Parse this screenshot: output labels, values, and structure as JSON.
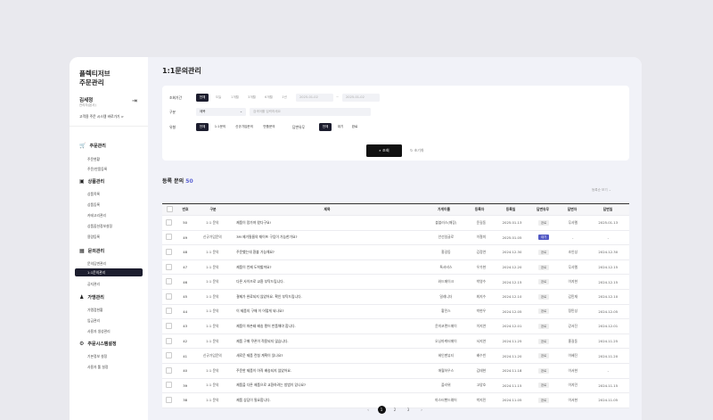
{
  "sidebar": {
    "brand_line1": "플렉티저브",
    "brand_line2": "주문관리",
    "user_name": "김세정",
    "user_sub": "관리자(본사)",
    "site_link": "고객용 주문 시스템 바로가기 >",
    "groups": [
      {
        "label": "주문관리",
        "items": [
          "주문현황",
          "주문/반품등록"
        ]
      },
      {
        "label": "상품관리",
        "items": [
          "상품목록",
          "상품등록",
          "카테고리관리",
          "상품옵션정보설정",
          "용량등록"
        ]
      },
      {
        "label": "문의관리",
        "items": [
          "문의답변관리",
          "1:1문의관리",
          "공지관리"
        ]
      },
      {
        "label": "가맹관리",
        "items": [
          "가맹점현황",
          "입금관리",
          "사용자 생성관리"
        ]
      },
      {
        "label": "주문시스템설정",
        "items": [
          "기본정보 설정",
          "사용자 툴 설정"
        ]
      }
    ]
  },
  "page_title": "1:1문의관리",
  "filter": {
    "period_label": "조회기간",
    "period_chips": [
      "전체",
      "오늘",
      "1개월",
      "3개월",
      "6개월",
      "1년"
    ],
    "date_from": "2025-01-02",
    "date_sep": "~",
    "date_to": "2025-01-02",
    "type_label": "구분",
    "type_select": "제목",
    "type_placeholder": "검색어를 입력하세요",
    "kind_label": "유형",
    "kind_chips": [
      "전체",
      "1:1문의",
      "신규가입문의",
      "반품문의"
    ],
    "answer_label": "답변유무",
    "answer_chips": [
      "전체",
      "대기",
      "완료"
    ],
    "search_btn": "조회",
    "reset_btn": "초기화"
  },
  "list": {
    "title": "등록 문의",
    "count": "50",
    "sort": "등록순 보기 ⌄",
    "columns": [
      "번호",
      "구분",
      "제목",
      "가게이름",
      "등록자",
      "등록일",
      "답변유무",
      "답변자",
      "답변일"
    ],
    "rows": [
      {
        "no": "50",
        "type": "1:1 문의",
        "title": "제품이 망가져 왔다구요!",
        "shop": "블블러스(매장)",
        "writer": "윤길동",
        "date": "2025.01.13",
        "status": "완료",
        "replier": "무사멜",
        "rdate": "2025.01.13"
      },
      {
        "no": "49",
        "type": "신규가입문의",
        "title": "3M 제거필름의 재이프 구입이 가능한가요?",
        "shop": "안선일글로",
        "writer": "이철미",
        "date": "2025.01.05",
        "status": "대기",
        "replier": "-",
        "rdate": "-"
      },
      {
        "no": "48",
        "type": "1:1 문의",
        "title": "주문했는데 환불 가능해요?",
        "shop": "홍길동",
        "writer": "김정연",
        "date": "2024.12.30",
        "status": "완료",
        "replier": "조인성",
        "rdate": "2024.12.30"
      },
      {
        "no": "47",
        "type": "1:1 문의",
        "title": "제품이 언제 도착할까요?",
        "shop": "톡서비스",
        "writer": "우가현",
        "date": "2024.12.20",
        "status": "완료",
        "replier": "무사멜",
        "rdate": "2024.12.15"
      },
      {
        "no": "46",
        "type": "1:1 문의",
        "title": "다른 사이즈로 교환 부탁드립니다.",
        "shop": "와드메이크",
        "writer": "박영수",
        "date": "2024.12.15",
        "status": "완료",
        "replier": "이지현",
        "rdate": "2024.12.15"
      },
      {
        "no": "45",
        "type": "1:1 문의",
        "title": "결제가 완료되지 않았어요. 확인 부탁드립니다.",
        "shop": "밀레니더",
        "writer": "최지수",
        "date": "2024.12.10",
        "status": "완료",
        "replier": "김민재",
        "rdate": "2024.12.10"
      },
      {
        "no": "44",
        "type": "1:1 문의",
        "title": "이 제품의 구매 이 어떻게 되나요?",
        "shop": "황민스",
        "writer": "박현우",
        "date": "2024.12.05",
        "status": "완료",
        "replier": "정민성",
        "rdate": "2024.12.05"
      },
      {
        "no": "43",
        "type": "1:1 문의",
        "title": "제품이 파손돼 배송 됐어 반품해야 합니다.",
        "shop": "윤미코랜드메이",
        "writer": "이지연",
        "date": "2024.12.01",
        "status": "완료",
        "replier": "강서진",
        "rdate": "2024.12.01"
      },
      {
        "no": "42",
        "type": "1:1 문의",
        "title": "제품 구매 쿠폰이 적용되지 않습니다.",
        "shop": "오닝마케터메이",
        "writer": "서지연",
        "date": "2024.11.25",
        "status": "완료",
        "replier": "홍길동",
        "rdate": "2024.11.25"
      },
      {
        "no": "41",
        "type": "신규가입문의",
        "title": "새로운 제품 런칭 계획이 있나요?",
        "shop": "헤인맨뷰티",
        "writer": "배수빈",
        "date": "2024.11.20",
        "status": "완료",
        "replier": "이혜진",
        "rdate": "2024.11.20"
      },
      {
        "no": "40",
        "type": "1:1 문의",
        "title": "주문한 제품이 아직 배송되지 않았어요.",
        "shop": "애월하우스",
        "writer": "김태현",
        "date": "2024.11.18",
        "status": "완료",
        "replier": "이서현",
        "rdate": "-"
      },
      {
        "no": "39",
        "type": "1:1 문의",
        "title": "제품을 다른 제품으로 교환하려는 방법이 있나요?",
        "shop": "플라위",
        "writer": "고양호",
        "date": "2024.11.15",
        "status": "완료",
        "replier": "이지민",
        "rdate": "2024.11.15"
      },
      {
        "no": "38",
        "type": "1:1 문의",
        "title": "제품 상담이 필요합니다.",
        "shop": "마스터핸드웨어",
        "writer": "박지민",
        "date": "2024.11.05",
        "status": "완료",
        "replier": "이서현",
        "rdate": "2024.11.05"
      }
    ]
  },
  "pager": {
    "prev": "‹",
    "pages": [
      "1",
      "2",
      "3"
    ],
    "next": "›"
  },
  "colors": {
    "accent": "#5158c4",
    "dark": "#1c1d2e"
  }
}
